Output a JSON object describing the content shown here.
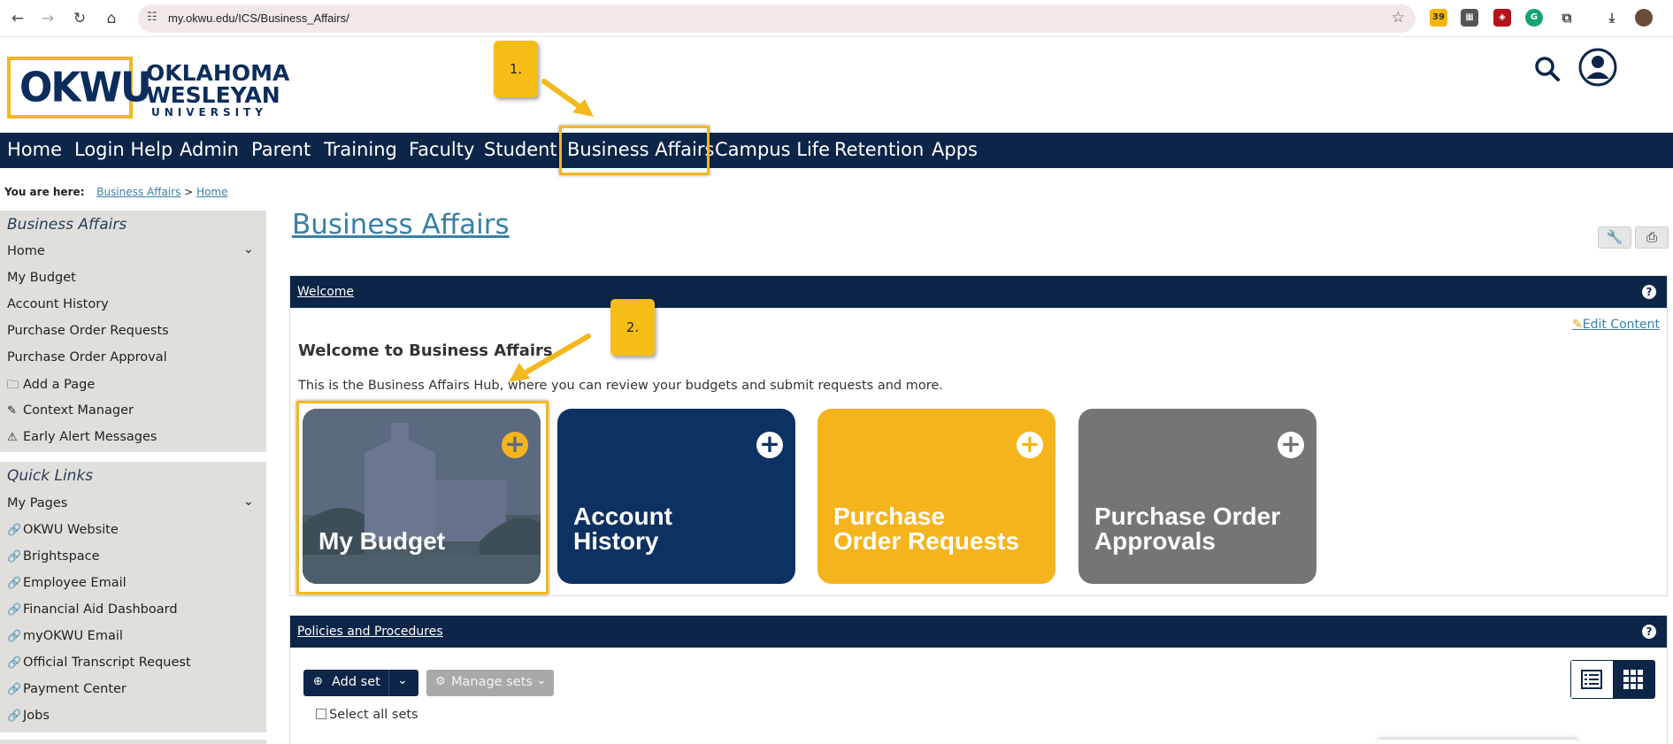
{
  "browser": {
    "url": "my.okwu.edu/ICS/Business_Affairs/",
    "extension_badge": "39"
  },
  "header": {
    "logo_mark": "OKWU",
    "logo_line1": "OKLAHOMA",
    "logo_line2": "WESLEYAN",
    "logo_line3": "UNIVERSITY"
  },
  "nav": {
    "items": [
      "Home",
      "Login Help",
      "Admin",
      "Parent",
      "Training",
      "Faculty",
      "Student",
      "Business Affairs",
      "Campus Life",
      "Retention",
      "Apps"
    ]
  },
  "breadcrumb": {
    "prefix": "You are here:",
    "crumb1": "Business Affairs",
    "sep": ">",
    "crumb2": "Home"
  },
  "sidebar": {
    "section_title": "Business Affairs",
    "items": [
      "Home",
      "My Budget",
      "Account History",
      "Purchase Order Requests",
      "Purchase Order Approval",
      "Add a Page",
      "Context Manager",
      "Early Alert Messages"
    ],
    "quick_title": "Quick Links",
    "quick_items": [
      "My Pages",
      "OKWU Website",
      "Brightspace",
      "Employee Email",
      "Financial Aid Dashboard",
      "myOKWU Email",
      "Official Transcript Request",
      "Payment Center",
      "Jobs"
    ]
  },
  "main": {
    "title": "Business Affairs",
    "welcome_portlet": "Welcome",
    "edit_content": "Edit Content",
    "welcome_heading": "Welcome to Business Affairs",
    "welcome_text": "This is the Business Affairs Hub, where you can review your budgets and submit requests and more.",
    "tiles": [
      {
        "line1": "My Budget",
        "line2": "",
        "color": "#5a6679"
      },
      {
        "line1": "Account",
        "line2": "History",
        "color": "#0d3163"
      },
      {
        "line1": "Purchase",
        "line2": "Order Requests",
        "color": "#f5b41b"
      },
      {
        "line1": "Purchase Order",
        "line2": "Approvals",
        "color": "#757575"
      }
    ],
    "policies_portlet": "Policies and Procedures",
    "add_set": "Add set",
    "manage_sets": "Manage sets",
    "select_all": "Select all sets"
  },
  "annotations": {
    "step1": "1.",
    "step2": "2."
  },
  "colors": {
    "navy": "#0c2548",
    "gold": "#f3b81d",
    "link": "#3a7fa6",
    "sidebar_bg": "#e1dfdc"
  }
}
